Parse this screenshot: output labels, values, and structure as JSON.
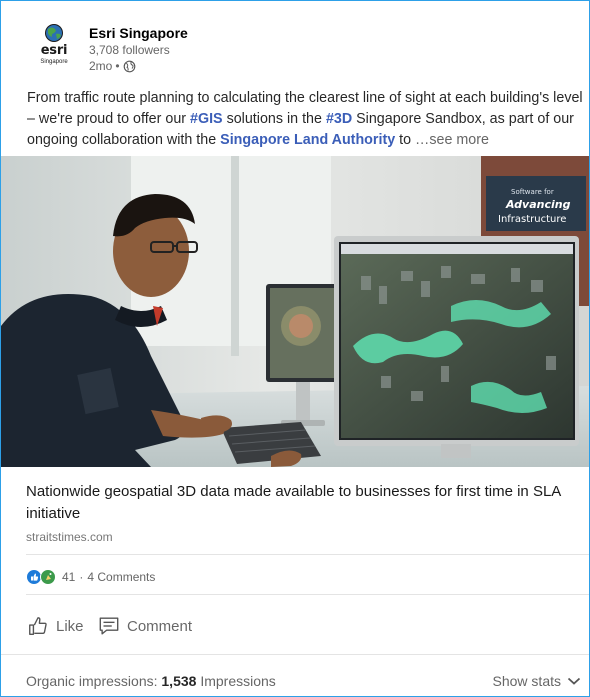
{
  "post": {
    "author": "Esri Singapore",
    "logo_word": "esri",
    "logo_sub": "Singapore",
    "followers": "3,708 followers",
    "age": "2mo",
    "separator": "•",
    "text": {
      "p1": "From traffic route planning to calculating the clearest line of sight at each building's level – we're proud to offer our ",
      "tag1": "#GIS",
      "p2": " solutions in the ",
      "tag2": "#3D",
      "p3": " Singapore Sandbox, as part of our ongoing collaboration with the ",
      "mention": "Singapore Land Authority",
      "p4": " to ",
      "see_more": "…see more"
    },
    "image": {
      "sign_line1": "Software for",
      "sign_line2": "Advancing",
      "sign_line3": "Infrastructure"
    }
  },
  "link": {
    "title": "Nationwide geospatial 3D data made available to businesses for first time in SLA initiative",
    "source": "straitstimes.com"
  },
  "social": {
    "reaction_count": "41",
    "dot": "·",
    "comments": "4 Comments"
  },
  "actions": {
    "like": "Like",
    "comment": "Comment"
  },
  "stats": {
    "label": "Organic impressions:",
    "value": "1,538",
    "unit": "Impressions",
    "show": "Show stats"
  },
  "colors": {
    "border": "#2da0e8",
    "hashtag": "#3b5eb8",
    "like_reaction": "#1e7bd9",
    "celebrate_reaction": "#3c9a4b"
  },
  "icons": [
    "globe-icon",
    "like-reaction-icon",
    "celebrate-reaction-icon",
    "thumbs-up-icon",
    "comment-icon",
    "chevron-down-icon"
  ]
}
